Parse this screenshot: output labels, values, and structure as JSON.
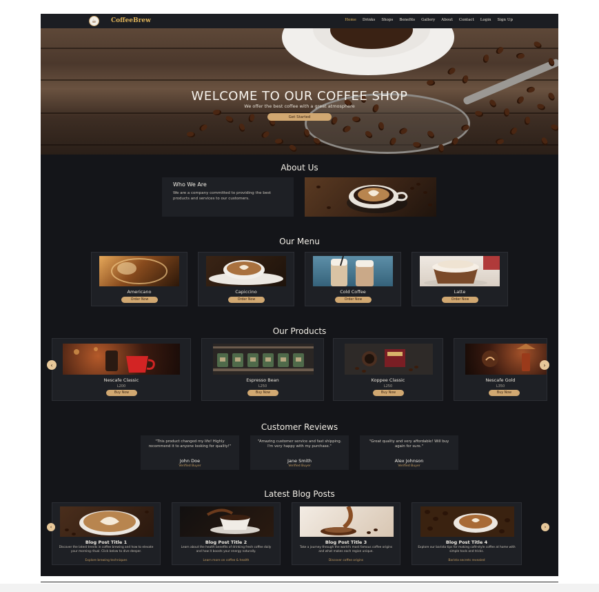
{
  "nav": {
    "brand": "CoffeeBrew",
    "logo_icon": "coffee-cup-icon",
    "links": [
      "Home",
      "Drinks",
      "Shops",
      "Benefits",
      "Gallery",
      "About",
      "Contact",
      "Login",
      "Sign Up"
    ],
    "active": "Home"
  },
  "hero": {
    "title": "WELCOME TO OUR COFFEE SHOP",
    "subtitle": "We offer the best coffee with a great atmosphere",
    "cta": "Get Started"
  },
  "about": {
    "title": "About Us",
    "heading": "Who We Are",
    "text": "We are a company committed to providing the best products and services to our customers."
  },
  "menu": {
    "title": "Our Menu",
    "items": [
      {
        "name": "Americano",
        "button": "Order Now"
      },
      {
        "name": "Capiccino",
        "button": "Order Now"
      },
      {
        "name": "Cold Coffee",
        "button": "Order Now"
      },
      {
        "name": "Latte",
        "button": "Order Now"
      }
    ]
  },
  "products": {
    "title": "Our Products",
    "prev_icon": "chevron-left-icon",
    "next_icon": "chevron-right-icon",
    "items": [
      {
        "name": "Nescafe Classic",
        "price": "L200",
        "button": "Buy Now"
      },
      {
        "name": "Espresso Bean",
        "price": "L250",
        "button": "Buy Now"
      },
      {
        "name": "Koppee Classic",
        "price": "L250",
        "button": "Buy Now"
      },
      {
        "name": "Nescafe Gold",
        "price": "L350",
        "button": "Buy Now"
      }
    ]
  },
  "reviews": {
    "title": "Customer Reviews",
    "items": [
      {
        "quote": "\"This product changed my life! Highly recommend it to anyone looking for quality!\"",
        "name": "John Doe",
        "role": "Verified Buyer"
      },
      {
        "quote": "\"Amazing customer service and fast shipping. I'm very happy with my purchase.\"",
        "name": "Jane Smith",
        "role": "Verified Buyer"
      },
      {
        "quote": "\"Great quality and very affordable! Will buy again for sure.\"",
        "name": "Alex Johnson",
        "role": "Verified Buyer"
      }
    ]
  },
  "blog": {
    "title": "Latest Blog Posts",
    "prev_icon": "chevron-left-icon",
    "next_icon": "chevron-right-icon",
    "posts": [
      {
        "title": "Blog Post Title 1",
        "text": "Discover the latest trends in coffee brewing and how to elevate your morning ritual. Click below to dive deeper.",
        "link": "Explore brewing techniques"
      },
      {
        "title": "Blog Post Title 2",
        "text": "Learn about the health benefits of drinking fresh coffee daily and how it boosts your energy naturally.",
        "link": "Learn more on coffee & health"
      },
      {
        "title": "Blog Post Title 3",
        "text": "Take a journey through the world's most famous coffee origins and what makes each region unique.",
        "link": "Discover coffee origins"
      },
      {
        "title": "Blog Post Title 4",
        "text": "Explore our barista tips for making café-style coffee at home with simple tools and tricks.",
        "link": "Barista secrets revealed"
      }
    ]
  },
  "colors": {
    "background": "#141519",
    "card": "#1e2025",
    "accent": "#d1a871",
    "brand": "#e0b45a"
  }
}
